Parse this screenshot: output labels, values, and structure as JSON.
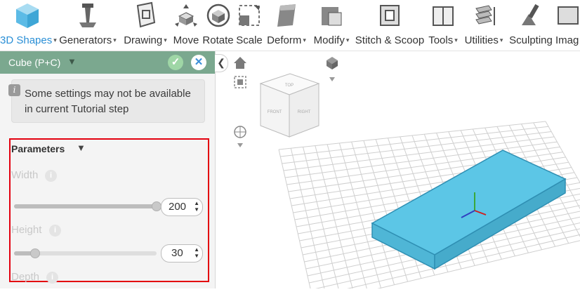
{
  "toolbar": {
    "items": [
      {
        "label": "3D Shapes",
        "caret": "▾",
        "icon": "cube-icon"
      },
      {
        "label": "Generators",
        "caret": "▾",
        "icon": "generator-icon"
      },
      {
        "label": "Drawing",
        "caret": "▾",
        "icon": "drawing-icon"
      },
      {
        "label": "Move",
        "caret": "",
        "icon": "move-icon"
      },
      {
        "label": "Rotate",
        "caret": "",
        "icon": "rotate-icon"
      },
      {
        "label": "Scale",
        "caret": "",
        "icon": "scale-icon"
      },
      {
        "label": "Deform",
        "caret": "▾",
        "icon": "deform-icon"
      },
      {
        "label": "Modify",
        "caret": "▾",
        "icon": "modify-icon"
      },
      {
        "label": "Stitch & Scoop",
        "caret": "",
        "icon": "stitch-scoop-icon"
      },
      {
        "label": "Tools",
        "caret": "▾",
        "icon": "tools-icon"
      },
      {
        "label": "Utilities",
        "caret": "▾",
        "icon": "utilities-icon"
      },
      {
        "label": "Sculpting",
        "caret": "",
        "icon": "sculpting-icon"
      },
      {
        "label": "Imag",
        "caret": "",
        "icon": "image-icon"
      }
    ]
  },
  "panel": {
    "title": "Cube (P+C)",
    "caret": "▼",
    "ok": "✓",
    "close": "✕",
    "info_icon": "i",
    "info_text": "Some settings may not be available in current Tutorial step",
    "params_title": "Parameters",
    "params_caret": "▼",
    "help": "i",
    "width": {
      "label": "Width",
      "value": "200",
      "slider_fraction": 1.0
    },
    "height": {
      "label": "Height",
      "value": "30",
      "slider_fraction": 0.15
    },
    "depth": {
      "label": "Depth"
    }
  },
  "viewport": {
    "collapse": "❮",
    "cube_faces": {
      "top": "TOP",
      "front": "FRONT",
      "right": "RIGHT"
    },
    "colors": {
      "box": "#66cbe9",
      "box_edge": "#2f8fb3",
      "grid": "#cfcfcf"
    }
  }
}
